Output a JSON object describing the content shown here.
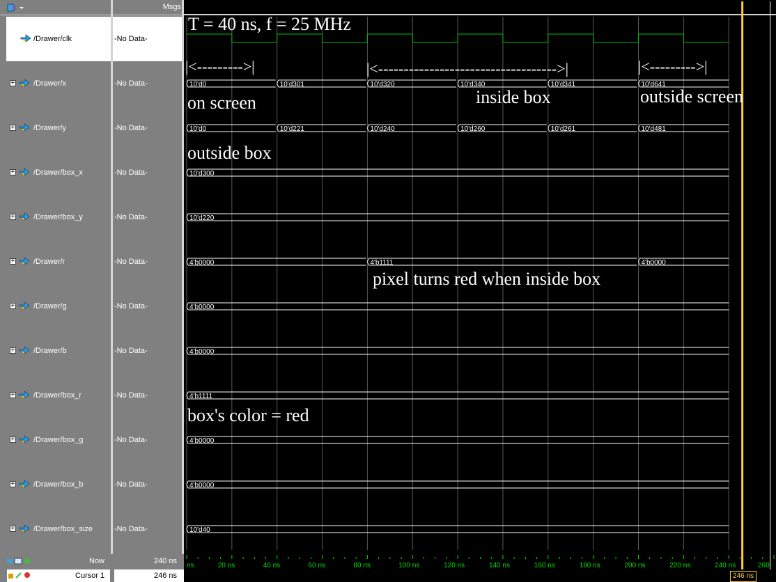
{
  "header": {
    "msgs_label": "Msgs"
  },
  "signals": [
    {
      "name": "/Drawer/clk",
      "value": "-No Data-",
      "expandable": false
    },
    {
      "name": "/Drawer/x",
      "value": "-No Data-",
      "expandable": true
    },
    {
      "name": "/Drawer/y",
      "value": "-No Data-",
      "expandable": true
    },
    {
      "name": "/Drawer/box_x",
      "value": "-No Data-",
      "expandable": true
    },
    {
      "name": "/Drawer/box_y",
      "value": "-No Data-",
      "expandable": true
    },
    {
      "name": "/Drawer/r",
      "value": "-No Data-",
      "expandable": true
    },
    {
      "name": "/Drawer/g",
      "value": "-No Data-",
      "expandable": true
    },
    {
      "name": "/Drawer/b",
      "value": "-No Data-",
      "expandable": true
    },
    {
      "name": "/Drawer/box_r",
      "value": "-No Data-",
      "expandable": true
    },
    {
      "name": "/Drawer/box_g",
      "value": "-No Data-",
      "expandable": true
    },
    {
      "name": "/Drawer/box_b",
      "value": "-No Data-",
      "expandable": true
    },
    {
      "name": "/Drawer/box_size",
      "value": "-No Data-",
      "expandable": true
    }
  ],
  "bus_values": {
    "x": [
      "10'd0",
      "10'd301",
      "10'd320",
      "10'd340",
      "10'd341",
      "10'd641"
    ],
    "y": [
      "10'd0",
      "10'd221",
      "10'd240",
      "10'd260",
      "10'd261",
      "10'd481"
    ],
    "box_x": [
      "10'd300"
    ],
    "box_y": [
      "10'd220"
    ],
    "r": [
      "4'b0000",
      "4'b1111",
      "4'b0000"
    ],
    "g": [
      "4'b0000"
    ],
    "b": [
      "4'b0000"
    ],
    "box_r": [
      "4'b1111"
    ],
    "box_g": [
      "4'b0000"
    ],
    "box_b": [
      "4'b0000"
    ],
    "box_size": [
      "10'd40"
    ]
  },
  "annotations": {
    "period": "T = 40 ns, f = 25 MHz",
    "arrow_short": "|<--------->|",
    "arrow_long": "|<----------------------------------->|",
    "arrow_short2": "|<--------->|",
    "on_screen": "on screen",
    "inside_box": "inside box",
    "outside_screen": "outside screen",
    "outside_box": "outside box",
    "pixel_red": "pixel turns red when inside box",
    "box_color": "box's color = red"
  },
  "footer": {
    "now_label": "Now",
    "now_value": "240 ns",
    "cursor_label": "Cursor 1",
    "cursor_value": "246 ns",
    "cursor_box": "246 ns"
  },
  "timeline": {
    "ticks": [
      "ns",
      "20 ns",
      "40 ns",
      "60 ns",
      "80 ns",
      "100 ns",
      "120 ns",
      "140 ns",
      "160 ns",
      "180 ns",
      "200 ns",
      "220 ns",
      "240 ns",
      "260"
    ],
    "cursor_ns": 246
  },
  "colors": {
    "clock": "#00c000",
    "cursor": "#ffcc33",
    "axis": "#00e000"
  },
  "icons": [
    "toolbar-icon",
    "signal-icon",
    "expand-icon"
  ]
}
